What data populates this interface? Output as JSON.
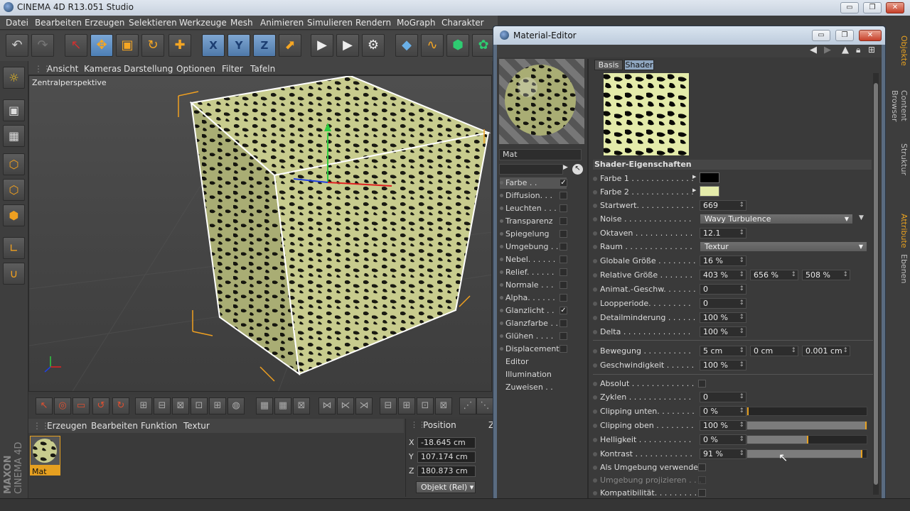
{
  "app": {
    "title": "CINEMA 4D R13.051 Studio",
    "window_buttons": {
      "minimize": "▭",
      "maximize": "❐",
      "close": "✕"
    }
  },
  "menubar": [
    "Datei",
    "Bearbeiten",
    "Erzeugen",
    "Selektieren",
    "Werkzeuge",
    "Mesh",
    "Animieren",
    "Simulieren",
    "Rendern",
    "MoGraph",
    "Charakter"
  ],
  "viewport": {
    "menu": [
      "Ansicht",
      "Kameras",
      "Darstellung",
      "Optionen",
      "Filter",
      "Tafeln"
    ],
    "label": "Zentralperspektive"
  },
  "toolbar": {
    "x_label": "X",
    "y_label": "Y",
    "z_label": "Z"
  },
  "material_manager": {
    "menu": [
      "Erzeugen",
      "Bearbeiten",
      "Funktion",
      "Textur"
    ],
    "material_name": "Mat"
  },
  "coordinates": {
    "header": "Position",
    "x_label": "X",
    "y_label": "Y",
    "z_label": "Z",
    "x_value": "-18.645 cm",
    "y_value": "107.174 cm",
    "z_value": "180.873 cm",
    "mode": "Objekt (Rel)",
    "extra_label": "Z"
  },
  "brand": {
    "line1": "MAXON",
    "line2": "CINEMA 4D"
  },
  "right_tabs": [
    "Objekte",
    "Content Browser",
    "Struktur",
    "Attribute",
    "Ebenen"
  ],
  "material_editor": {
    "title": "Material-Editor",
    "name_field": "Mat",
    "tabs": [
      "Basis",
      "Shader"
    ],
    "active_tab": "Shader",
    "channels": [
      {
        "label": "Farbe . .",
        "checked": true,
        "selected": true
      },
      {
        "label": "Diffusion. . .",
        "checked": false
      },
      {
        "label": "Leuchten . . .",
        "checked": false
      },
      {
        "label": "Transparenz",
        "checked": false
      },
      {
        "label": "Spiegelung",
        "checked": false
      },
      {
        "label": "Umgebung . .",
        "checked": false
      },
      {
        "label": "Nebel. . . . . .",
        "checked": false
      },
      {
        "label": "Relief. . . . . .",
        "checked": false
      },
      {
        "label": "Normale . . .",
        "checked": false
      },
      {
        "label": "Alpha. . . . . .",
        "checked": false
      },
      {
        "label": "Glanzlicht . .",
        "checked": true
      },
      {
        "label": "Glanzfarbe . .",
        "checked": false
      },
      {
        "label": "Glühen . . . .",
        "checked": false
      },
      {
        "label": "Displacement",
        "checked": false
      }
    ],
    "extra_links": [
      "Editor",
      "Illumination",
      "Zuweisen . ."
    ],
    "section_title": "Shader-Eigenschaften",
    "params": {
      "farbe1": {
        "label": "Farbe 1 . . . . . . . . . . . . .",
        "color": "#000000"
      },
      "farbe2": {
        "label": "Farbe 2 . . . . . . . . . . . . .",
        "color": "#e4ebaa"
      },
      "startwert": {
        "label": "Startwert. . . . . . . . . . . .",
        "value": "669"
      },
      "noise": {
        "label": "Noise . . . . . . . . . . . . . .",
        "value": "Wavy Turbulence"
      },
      "oktaven": {
        "label": "Oktaven . . . . . . . . . . . .",
        "value": "12.1"
      },
      "raum": {
        "label": "Raum . . . . . . . . . . . . . .",
        "value": "Textur"
      },
      "globale": {
        "label": "Globale Größe . . . . . . . .",
        "value": "16 %"
      },
      "relative": {
        "label": "Relative Größe . . . . . . .",
        "v1": "403 %",
        "v2": "656 %",
        "v3": "508 %"
      },
      "animat": {
        "label": "Animat.-Geschw. . . . . . .",
        "value": "0"
      },
      "looperiode": {
        "label": "Loopperiode. . . . . . . . .",
        "value": "0"
      },
      "detail": {
        "label": "Detailminderung . . . . . .",
        "value": "100 %"
      },
      "delta": {
        "label": "Delta . . . . . . . . . . . . . .",
        "value": "100 %"
      },
      "bewegung": {
        "label": "Bewegung . . . . . . . . . .",
        "v1": "5 cm",
        "v2": "0 cm",
        "v3": "0.001 cm"
      },
      "geschw": {
        "label": "Geschwindigkeit . . . . . .",
        "value": "100 %"
      },
      "absolut": {
        "label": "Absolut . . . . . . . . . . . . .",
        "checked": false
      },
      "zyklen": {
        "label": "Zyklen . . . . . . . . . . . . .",
        "value": "0"
      },
      "clip_unten": {
        "label": "Clipping unten. . . . . . . .",
        "value": "0 %",
        "level": 0
      },
      "clip_oben": {
        "label": "Clipping oben . . . . . . . .",
        "value": "100 %",
        "level": 1
      },
      "helligkeit": {
        "label": "Helligkeit . . . . . . . . . . .",
        "value": "0 %",
        "level": 0.5
      },
      "kontrast": {
        "label": "Kontrast . . . . . . . . . . . .",
        "value": "91 %",
        "level": 0.955
      },
      "als_umgebung": {
        "label": "Als Umgebung verwenden",
        "checked": false
      },
      "umgebung_proj": {
        "label": "Umgebung projizieren . . .",
        "checked": false
      },
      "kompat": {
        "label": "Kompatibilität. . . . . . . . .",
        "checked": false
      }
    }
  }
}
